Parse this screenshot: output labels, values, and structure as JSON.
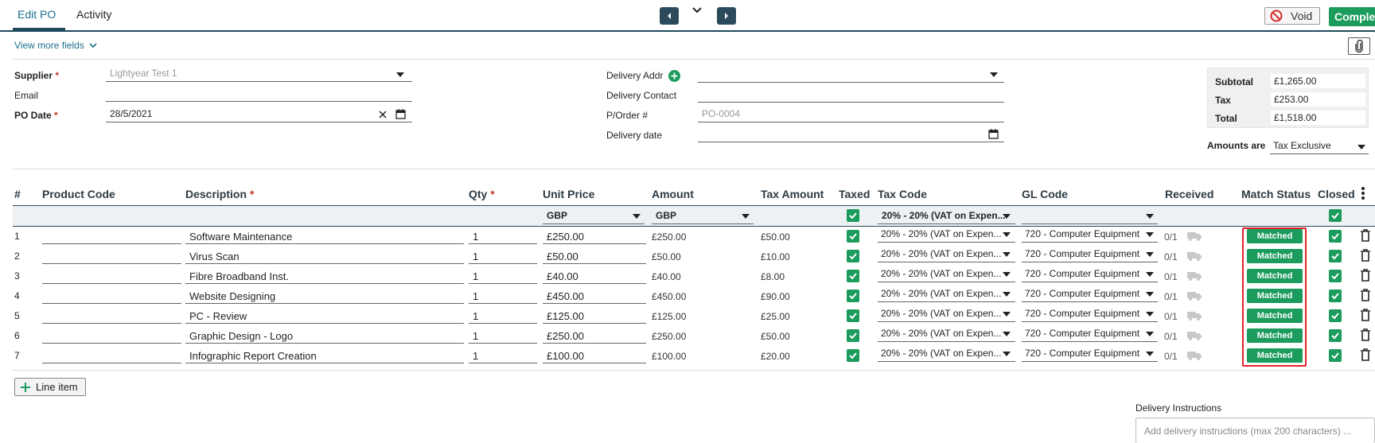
{
  "tabs": {
    "edit": "Edit PO",
    "activity": "Activity"
  },
  "actions": {
    "void": "Void",
    "complete": "Complete"
  },
  "view_more": "View more fields",
  "form": {
    "supplier_label": "Supplier",
    "supplier_value": "Lightyear Test 1",
    "email_label": "Email",
    "po_date_label": "PO Date",
    "po_date_value": "28/5/2021",
    "delivery_addr_label": "Delivery Addr",
    "delivery_contact_label": "Delivery Contact",
    "porder_label": "P/Order #",
    "porder_placeholder": "PO-0004",
    "delivery_date_label": "Delivery date"
  },
  "totals": {
    "subtotal_label": "Subtotal",
    "subtotal": "£1,265.00",
    "tax_label": "Tax",
    "tax": "£253.00",
    "total_label": "Total",
    "total": "£1,518.00",
    "amounts_label": "Amounts are",
    "amounts_value": "Tax Exclusive"
  },
  "table": {
    "headers": {
      "num": "#",
      "product_code": "Product Code",
      "description": "Description",
      "qty": "Qty",
      "unit_price": "Unit Price",
      "amount": "Amount",
      "tax_amount": "Tax Amount",
      "taxed": "Taxed",
      "tax_code": "Tax Code",
      "gl_code": "GL Code",
      "received": "Received",
      "match_status": "Match Status",
      "closed": "Closed"
    },
    "band": {
      "unit_currency": "GBP",
      "amount_currency": "GBP",
      "tax_code": "20% - 20% (VAT on Expen..."
    },
    "rows": [
      {
        "num": "1",
        "description": "Software Maintenance",
        "qty": "1",
        "unit_price": "£250.00",
        "amount": "£250.00",
        "tax_amount": "£50.00",
        "tax_code": "20% - 20% (VAT on Expen...",
        "gl_code": "720 - Computer Equipment",
        "received": "0/1",
        "status": "Matched"
      },
      {
        "num": "2",
        "description": "Virus Scan",
        "qty": "1",
        "unit_price": "£50.00",
        "amount": "£50.00",
        "tax_amount": "£10.00",
        "tax_code": "20% - 20% (VAT on Expen...",
        "gl_code": "720 - Computer Equipment",
        "received": "0/1",
        "status": "Matched"
      },
      {
        "num": "3",
        "description": "Fibre Broadband Inst.",
        "qty": "1",
        "unit_price": "£40.00",
        "amount": "£40.00",
        "tax_amount": "£8.00",
        "tax_code": "20% - 20% (VAT on Expen...",
        "gl_code": "720 - Computer Equipment",
        "received": "0/1",
        "status": "Matched"
      },
      {
        "num": "4",
        "description": "Website Designing",
        "qty": "1",
        "unit_price": "£450.00",
        "amount": "£450.00",
        "tax_amount": "£90.00",
        "tax_code": "20% - 20% (VAT on Expen...",
        "gl_code": "720 - Computer Equipment",
        "received": "0/1",
        "status": "Matched"
      },
      {
        "num": "5",
        "description": "PC - Review",
        "qty": "1",
        "unit_price": "£125.00",
        "amount": "£125.00",
        "tax_amount": "£25.00",
        "tax_code": "20% - 20% (VAT on Expen...",
        "gl_code": "720 - Computer Equipment",
        "received": "0/1",
        "status": "Matched"
      },
      {
        "num": "6",
        "description": "Graphic Design - Logo",
        "qty": "1",
        "unit_price": "£250.00",
        "amount": "£250.00",
        "tax_amount": "£50.00",
        "tax_code": "20% - 20% (VAT on Expen...",
        "gl_code": "720 - Computer Equipment",
        "received": "0/1",
        "status": "Matched"
      },
      {
        "num": "7",
        "description": "Infographic Report Creation",
        "qty": "1",
        "unit_price": "£100.00",
        "amount": "£100.00",
        "tax_amount": "£20.00",
        "tax_code": "20% - 20% (VAT on Expen...",
        "gl_code": "720 - Computer Equipment",
        "received": "0/1",
        "status": "Matched"
      }
    ]
  },
  "line_item": "Line item",
  "delivery_instructions_label": "Delivery Instructions",
  "delivery_instructions_placeholder": "Add delivery instructions (max 200 characters) ...",
  "colors": {
    "accent": "#1a6f8c",
    "nav": "#2d4a5c",
    "success": "#1b9b5c",
    "highlight": "#e0232a"
  },
  "icons": [
    "prev-arrow-icon",
    "chevron-down-icon",
    "next-arrow-icon",
    "void-icon",
    "paperclip-icon",
    "plus-circle-icon",
    "clear-icon",
    "calendar-icon",
    "more-vert-icon",
    "checkbox-icon",
    "truck-icon",
    "trash-icon",
    "plus-icon"
  ]
}
